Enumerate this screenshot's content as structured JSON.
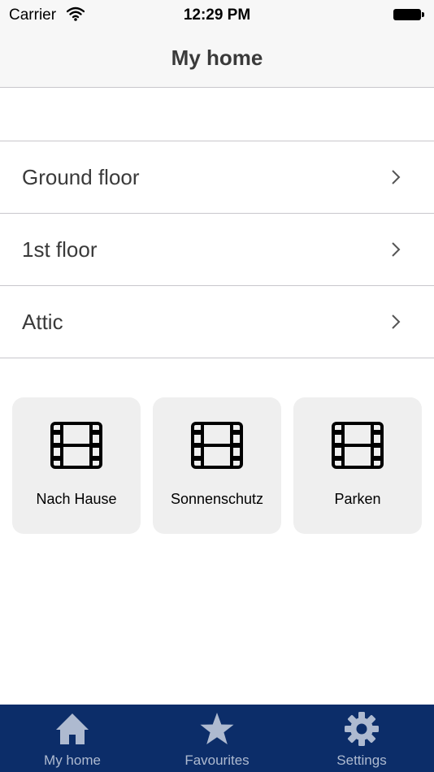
{
  "status_bar": {
    "carrier": "Carrier",
    "time": "12:29 PM"
  },
  "nav": {
    "title": "My home"
  },
  "floors": [
    {
      "label": "Ground floor"
    },
    {
      "label": "1st floor"
    },
    {
      "label": "Attic"
    }
  ],
  "scenes": [
    {
      "label": "Nach Hause",
      "icon": "film-icon"
    },
    {
      "label": "Sonnenschutz",
      "icon": "film-icon"
    },
    {
      "label": "Parken",
      "icon": "film-icon"
    }
  ],
  "tab_bar": {
    "items": [
      {
        "label": "My home",
        "icon": "home-icon"
      },
      {
        "label": "Favourites",
        "icon": "star-icon"
      },
      {
        "label": "Settings",
        "icon": "gear-icon"
      }
    ]
  },
  "colors": {
    "tab_bar_bg": "#0c2d69",
    "tab_icon": "#aebad0",
    "tile_bg": "#efefef",
    "separator": "#c8c7cc"
  }
}
